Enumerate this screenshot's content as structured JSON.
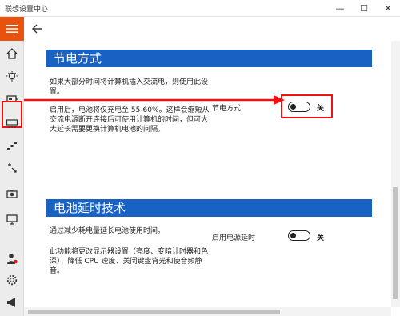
{
  "window": {
    "title": "联想设置中心",
    "minimize": "—",
    "maximize": "☐",
    "close": "✕"
  },
  "sections": {
    "power_saving": {
      "header": "节电方式",
      "para1": "如果大部分时间将计算机插入交流电，则使用此设置。",
      "para2": "启用后，电池将仅充电至 55-60%。这样会缩短从交流电源断开连接后可使用计算机的时间，但可大大延长需要更换计算机电池的间隔。",
      "setting_label": "节电方式",
      "toggle_state": "关"
    },
    "battery_extend": {
      "header": "电池延时技术",
      "para1": "通过减少耗电量延长电池使用时间。",
      "para2": "此功能将更改显示器设置（亮度、变暗计时器和色深）、降低 CPU 速度、关闭键盘背光和使音频静音。",
      "setting_label": "启用电源延时",
      "toggle_state": "关"
    }
  },
  "colors": {
    "accent": "#e9510e",
    "section_header": "#1962c4",
    "annotation": "#ee1111"
  }
}
